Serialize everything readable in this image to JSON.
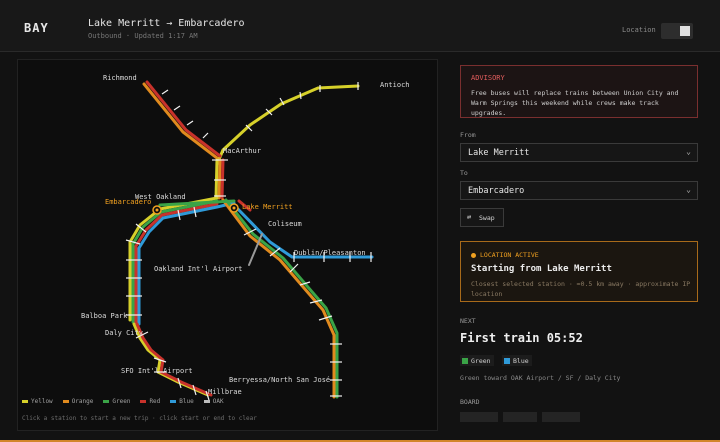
{
  "header": {
    "brand": "BAY",
    "route_title": "Lake Merritt → Embarcadero",
    "route_subtitle": "Outbound · Updated 1:17 AM",
    "location_label": "Location"
  },
  "colors": {
    "yellow": "#d6d02a",
    "orange": "#e08a1e",
    "green": "#3aa347",
    "red": "#c8322b",
    "blue": "#2f9ad8",
    "oak": "#bdbdbd",
    "accent": "#f0a020"
  },
  "map": {
    "stations": {
      "richmond": "Richmond",
      "antioch": "Antioch",
      "macarthur": "MacArthur",
      "west_oakland": "West Oakland",
      "embarcadero": "Embarcadero",
      "lake_merritt": "Lake Merritt",
      "coliseum": "Coliseum",
      "dublin": "Dublin/Pleasanton",
      "oakland_airport": "Oakland Int'l Airport",
      "balboa_park": "Balboa Park",
      "daly_city": "Daly City",
      "sfo": "SFO Int'l Airport",
      "millbrae": "Millbrae",
      "berryessa": "Berryessa/North San José"
    },
    "legend": [
      "Yellow",
      "Orange",
      "Green",
      "Red",
      "Blue",
      "OAK"
    ],
    "hint": "Click a station to start a new trip · click start or end to clear"
  },
  "advisory": {
    "title": "ADVISORY",
    "text": "Free buses will replace trains between Union City and Warm Springs this weekend while crews make track upgrades."
  },
  "form": {
    "from_label": "From",
    "from_value": "Lake Merritt",
    "to_label": "To",
    "to_value": "Embarcadero",
    "swap_label": "Swap",
    "swap_icon": "⇄"
  },
  "location_card": {
    "title": "LOCATION ACTIVE",
    "heading": "Starting from Lake Merritt",
    "note": "Closest selected station · ≈0.5 km away · approximate IP location"
  },
  "next": {
    "label": "NEXT",
    "time": "First train 05:52",
    "lines": [
      "Green",
      "Blue"
    ],
    "destination": "Green toward OAK Airport / SF / Daly City"
  },
  "board": {
    "label": "BOARD"
  }
}
